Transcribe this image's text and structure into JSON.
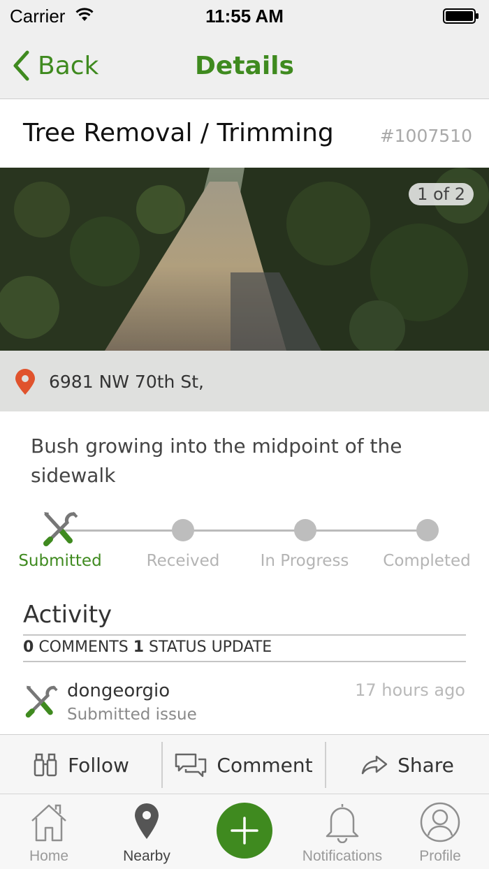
{
  "status_bar": {
    "carrier": "Carrier",
    "time": "11:55 AM"
  },
  "nav": {
    "back_label": "Back",
    "title": "Details"
  },
  "issue": {
    "title": "Tree Removal / Trimming",
    "id": "#1007510",
    "photo_counter": "1 of 2",
    "address": "6981  NW 70th St,",
    "description": "Bush growing into the midpoint of the sidewalk"
  },
  "progress": {
    "steps": [
      "Submitted",
      "Received",
      "In Progress",
      "Completed"
    ],
    "current_step": 1
  },
  "activity": {
    "title": "Activity",
    "comments_count": "0",
    "comments_label": "COMMENTS",
    "status_count": "1",
    "status_label": "STATUS UPDATE",
    "items": [
      {
        "user": "dongeorgio",
        "action": "Submitted issue",
        "time": "17 hours ago"
      }
    ]
  },
  "actions": {
    "follow": "Follow",
    "comment": "Comment",
    "share": "Share"
  },
  "tabs": [
    {
      "label": "Home",
      "icon": "home-icon"
    },
    {
      "label": "Nearby",
      "icon": "map-pin-icon"
    },
    {
      "label": "",
      "icon": "add-icon"
    },
    {
      "label": "Notifications",
      "icon": "bell-icon"
    },
    {
      "label": "Profile",
      "icon": "user-icon"
    }
  ],
  "colors": {
    "accent": "#3f8a1f",
    "pin": "#e0532d",
    "tab_inactive": "#9a9a9a"
  }
}
